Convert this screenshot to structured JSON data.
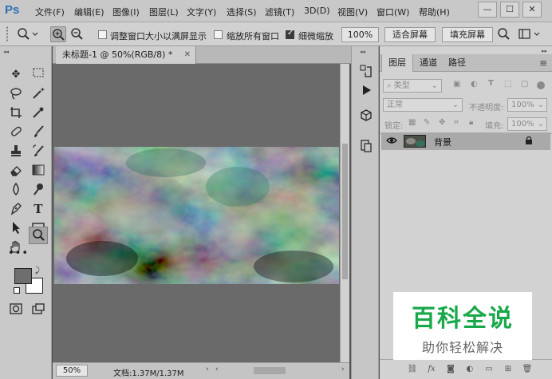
{
  "app": {
    "logo": "Ps"
  },
  "menu": [
    "文件(F)",
    "编辑(E)",
    "图像(I)",
    "图层(L)",
    "文字(Y)",
    "选择(S)",
    "滤镜(T)",
    "3D(D)",
    "视图(V)",
    "窗口(W)",
    "帮助(H)"
  ],
  "window_controls": {
    "minimize": "—",
    "maximize": "☐",
    "close": "✕"
  },
  "options": {
    "resize_windows": {
      "label": "调整窗口大小以满屏显示",
      "checked": false
    },
    "zoom_all": {
      "label": "缩放所有窗口",
      "checked": false
    },
    "scrubby_zoom": {
      "label": "细微缩放",
      "checked": true
    },
    "zoom_100": "100%",
    "fit_screen": "适合屏幕",
    "fill_screen": "填充屏幕"
  },
  "document": {
    "tab_title": "未标题-1 @ 50%(RGB/8) *",
    "zoom": "50%",
    "status": "文档:1.37M/1.37M"
  },
  "panel": {
    "tabs": [
      "图层",
      "通道",
      "路径"
    ],
    "active_tab": "图层",
    "filter_kind": "类型",
    "blend_mode": "正常",
    "opacity_label": "不透明度:",
    "opacity_value": "100%",
    "lock_label": "锁定:",
    "fill_label": "填充:",
    "fill_value": "100%",
    "layers": [
      {
        "name": "背景",
        "visible": true,
        "locked": true
      }
    ]
  },
  "watermark": {
    "title": "百科全说",
    "subtitle": "助你轻松解决"
  },
  "colors": {
    "foreground": "#6e6e6e",
    "background": "#ffffff",
    "accent_green": "#18a84a"
  }
}
